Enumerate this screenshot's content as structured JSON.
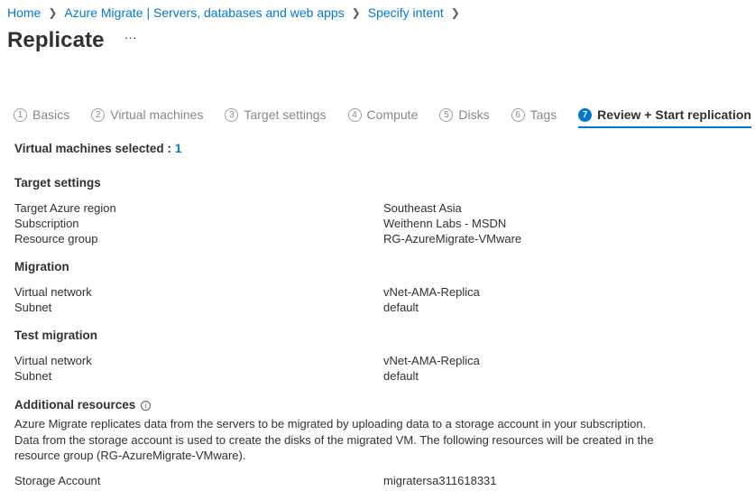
{
  "breadcrumb": [
    {
      "label": "Home"
    },
    {
      "label": "Azure Migrate | Servers, databases and web apps"
    },
    {
      "label": "Specify intent"
    }
  ],
  "title": "Replicate",
  "more_label": "···",
  "tabs": [
    {
      "num": "1",
      "label": "Basics"
    },
    {
      "num": "2",
      "label": "Virtual machines"
    },
    {
      "num": "3",
      "label": "Target settings"
    },
    {
      "num": "4",
      "label": "Compute"
    },
    {
      "num": "5",
      "label": "Disks"
    },
    {
      "num": "6",
      "label": "Tags"
    },
    {
      "num": "7",
      "label": "Review + Start replication"
    }
  ],
  "vm_selected": {
    "label": "Virtual machines selected :",
    "count": "1"
  },
  "target_settings": {
    "title": "Target settings",
    "rows": [
      {
        "label": "Target Azure region",
        "value": "Southeast Asia"
      },
      {
        "label": "Subscription",
        "value": "Weithenn Labs - MSDN"
      },
      {
        "label": "Resource group",
        "value": "RG-AzureMigrate-VMware"
      }
    ]
  },
  "migration": {
    "title": "Migration",
    "rows": [
      {
        "label": "Virtual network",
        "value": "vNet-AMA-Replica"
      },
      {
        "label": "Subnet",
        "value": "default"
      }
    ]
  },
  "test_migration": {
    "title": "Test migration",
    "rows": [
      {
        "label": "Virtual network",
        "value": "vNet-AMA-Replica"
      },
      {
        "label": "Subnet",
        "value": "default"
      }
    ]
  },
  "additional_resources": {
    "title": "Additional resources",
    "info_icon": "info-icon",
    "description": "Azure Migrate replicates data from the servers to be migrated by uploading data to a storage account in your subscription. Data from the storage account is used to create the disks of the migrated VM. The following resources will be created in the resource group (RG-AzureMigrate-VMware).",
    "rows": [
      {
        "label": "Storage Account",
        "value": "migratersa311618331"
      }
    ]
  },
  "colors": {
    "accent": "#0078d4",
    "text": "#323130",
    "muted": "#8a8886"
  }
}
